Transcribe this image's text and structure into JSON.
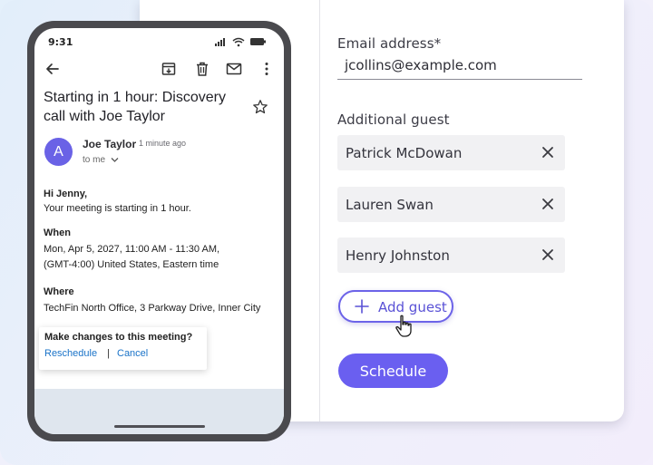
{
  "phone": {
    "status_time": "9:31",
    "toolbar_icons": [
      "back-arrow-icon",
      "archive-icon",
      "trash-icon",
      "mail-icon",
      "more-vert-icon"
    ],
    "subject": "Starting in 1 hour: Discovery call with Joe Taylor",
    "sender": {
      "avatar_letter": "A",
      "name": "Joe Taylor",
      "time_ago": "1 minute ago",
      "recipient": "to me"
    },
    "body": {
      "greeting": "Hi Jenny,",
      "intro": "Your meeting is starting in 1 hour.",
      "when_heading": "When",
      "when_line1": "Mon, Apr 5, 2027, 11:00 AM - 11:30 AM,",
      "when_line2": "(GMT-4:00) United States, Eastern time",
      "where_heading": "Where",
      "where_value": "TechFin North Office, 3 Parkway Drive, Inner City"
    },
    "changes": {
      "title": "Make changes to this meeting?",
      "reschedule": "Reschedule",
      "separator": "|",
      "cancel": "Cancel"
    }
  },
  "form": {
    "email_label": "Email address*",
    "email_value": "jcollins@example.com",
    "guest_label": "Additional guest",
    "guests": [
      {
        "name": "Patrick McDowan"
      },
      {
        "name": "Lauren Swan"
      },
      {
        "name": "Henry Johnston"
      }
    ],
    "add_guest_label": "Add guest",
    "schedule_label": "Schedule"
  },
  "colors": {
    "accent": "#6a5ff0",
    "avatar": "#6a62e6",
    "link": "#1a73c8",
    "phone_frame": "#4a4a4e"
  }
}
